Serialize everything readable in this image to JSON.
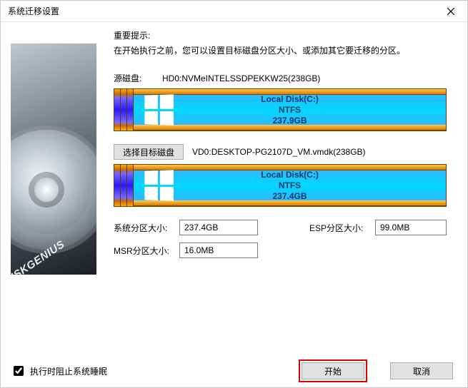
{
  "window": {
    "title": "系统迁移设置"
  },
  "sidebar": {
    "brand": "DISKGENIUS"
  },
  "hint": {
    "title": "重要提示:",
    "body": "在开始执行之前，您可以设置目标磁盘分区大小、或添加其它要迁移的分区。"
  },
  "source": {
    "label": "源磁盘:",
    "name": "HD0:NVMeINTELSSDPEKKW25(238GB)",
    "partition": {
      "title": "Local Disk(C:)",
      "fs": "NTFS",
      "size": "237.9GB"
    }
  },
  "target": {
    "button": "选择目标磁盘",
    "name": "VD0:DESKTOP-PG2107D_VM.vmdk(238GB)",
    "partition": {
      "title": "Local Disk(C:)",
      "fs": "NTFS",
      "size": "237.4GB"
    }
  },
  "fields": {
    "system_label": "系统分区大小:",
    "system_value": "237.4GB",
    "esp_label": "ESP分区大小:",
    "esp_value": "99.0MB",
    "msr_label": "MSR分区大小:",
    "msr_value": "16.0MB"
  },
  "footer": {
    "sleep_label": "执行时阻止系统睡眠",
    "start": "开始",
    "cancel": "取消"
  }
}
